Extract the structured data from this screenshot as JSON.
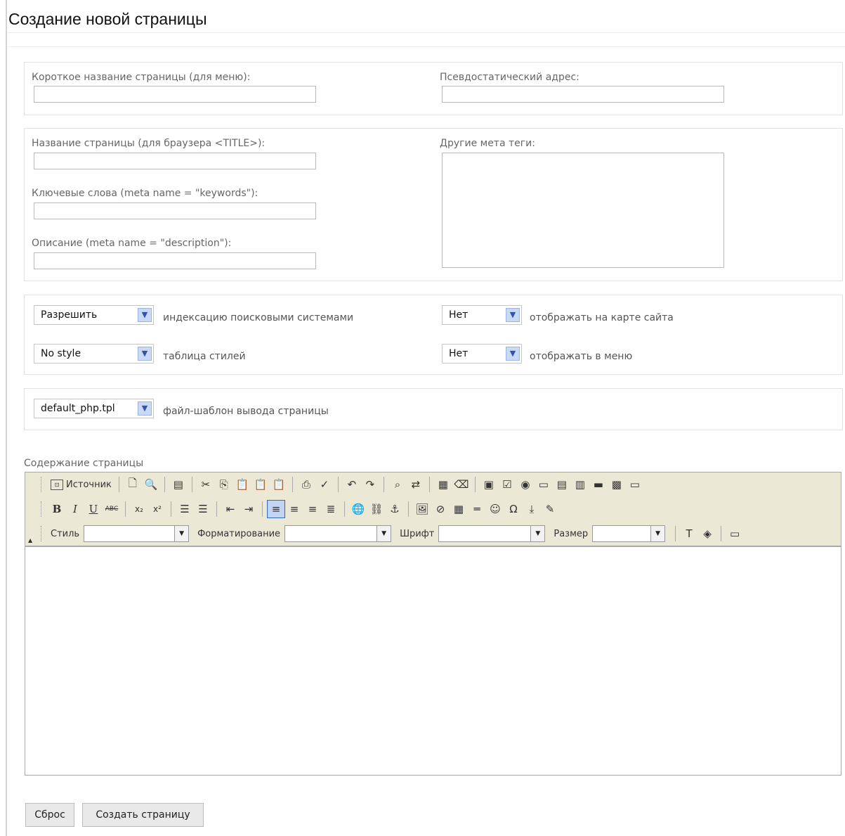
{
  "page": {
    "title": "Создание новой страницы"
  },
  "block1": {
    "short_name_label": "Короткое название страницы (для меню):",
    "short_name_value": "",
    "pseudo_url_label": "Псевдостатический адрес:",
    "pseudo_url_value": ""
  },
  "block2": {
    "title_label": "Название страницы (для браузера <TITLE>):",
    "title_value": "",
    "keywords_label": "Ключевые слова (meta name = \"keywords\"):",
    "keywords_value": "",
    "description_label": "Описание (meta name = \"description\"):",
    "description_value": "",
    "meta_label": "Другие мета теги:",
    "meta_value": ""
  },
  "block3": {
    "indexing": {
      "value": "Разрешить",
      "label": "индексацию поисковыми системами"
    },
    "stylesheet": {
      "value": "No style",
      "label": "таблица стилей"
    },
    "sitemap": {
      "value": "Нет",
      "label": "отображать на карте сайта"
    },
    "menu": {
      "value": "Нет",
      "label": "отображать в меню"
    }
  },
  "block4": {
    "template": {
      "value": "default_php.tpl",
      "label": "файл-шаблон вывода страницы"
    }
  },
  "editor": {
    "label": "Содержание страницы",
    "source_label": "Источник",
    "style_label": "Стиль",
    "format_label": "Форматирование",
    "font_label": "Шрифт",
    "size_label": "Размер"
  },
  "buttons": {
    "reset": "Сброс",
    "create": "Создать страницу"
  }
}
